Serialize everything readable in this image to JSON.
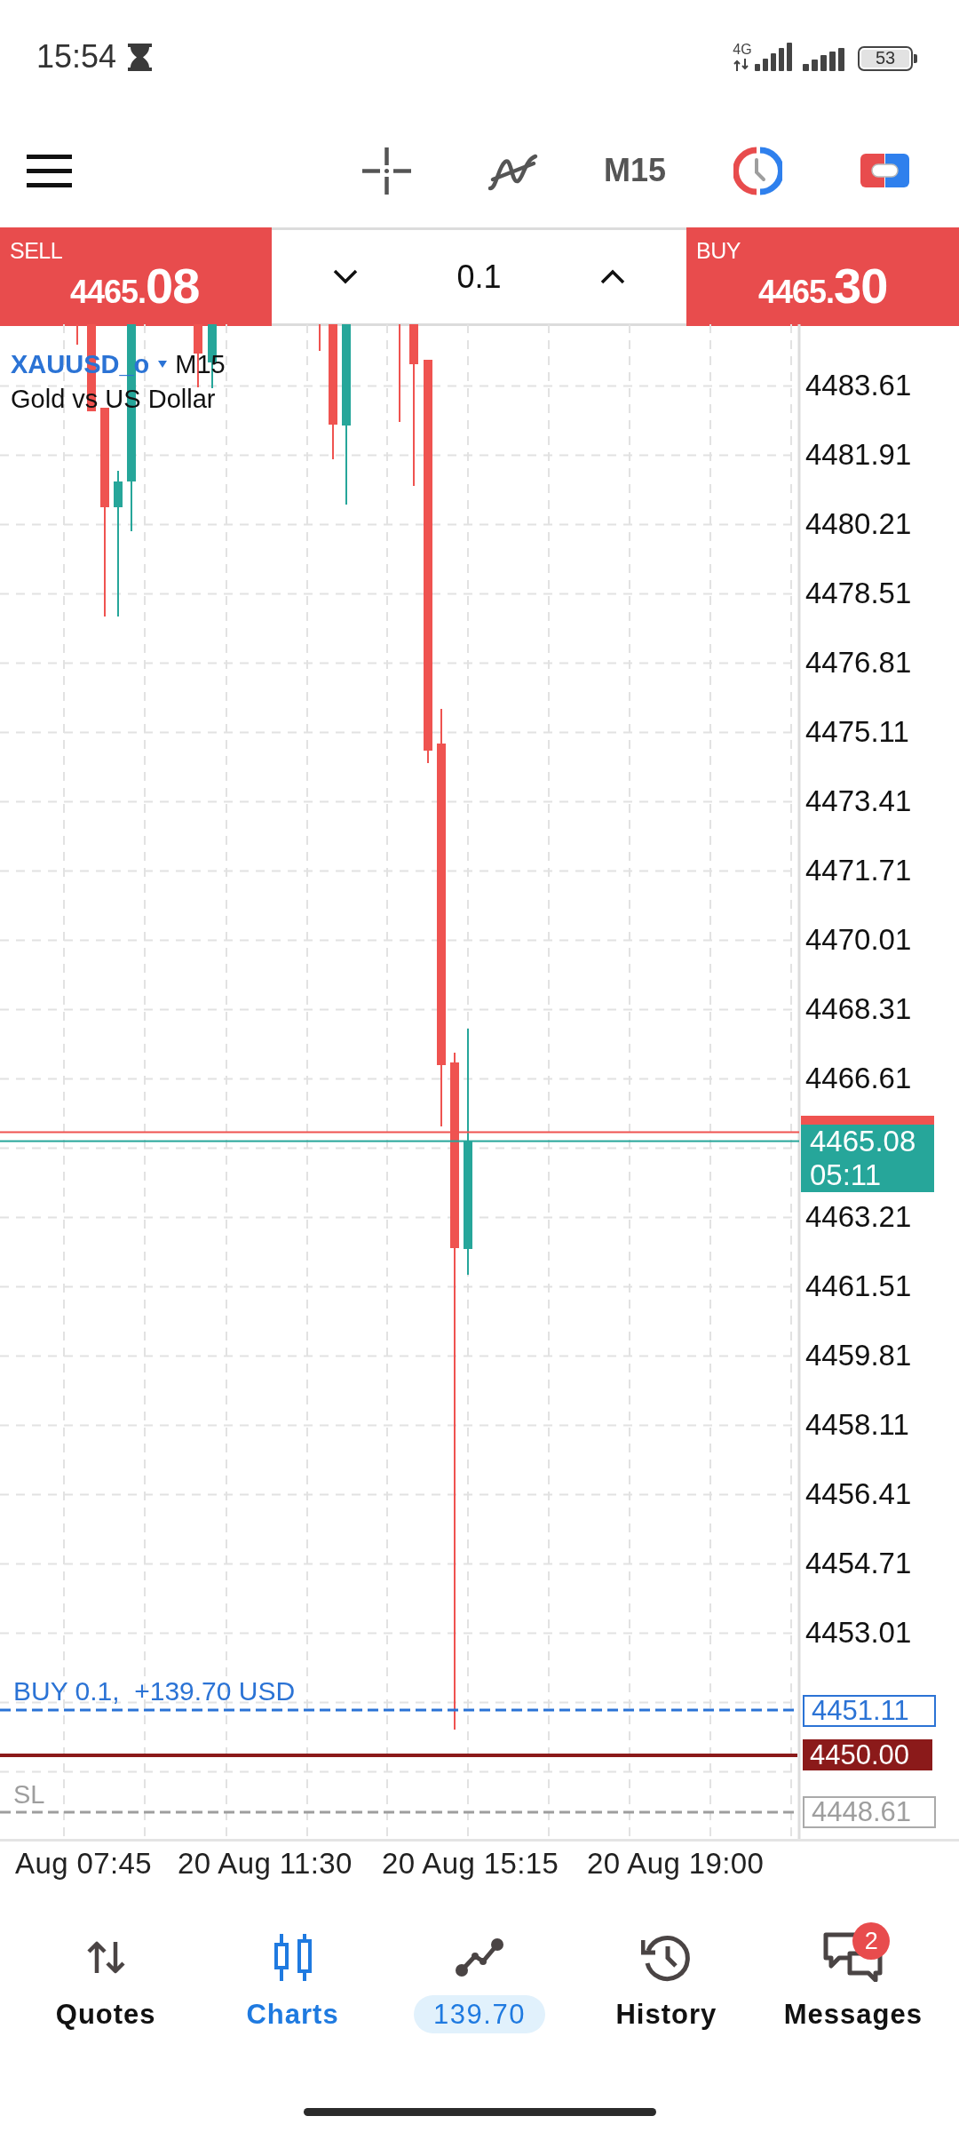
{
  "status_bar": {
    "time": "15:54",
    "network": "4G",
    "battery": "53"
  },
  "toolbar": {
    "timeframe": "M15"
  },
  "trade_panel": {
    "sell": {
      "label": "SELL",
      "price_main": "4465.",
      "price_pips": "08"
    },
    "volume": "0.1",
    "buy": {
      "label": "BUY",
      "price_main": "4465.",
      "price_pips": "30"
    }
  },
  "chart": {
    "symbol": "XAUUSD_o",
    "timeframe": "M15",
    "description": "Gold vs US Dollar",
    "price_axis": [
      "4483.61",
      "4481.91",
      "4480.21",
      "4478.51",
      "4476.81",
      "4475.11",
      "4473.41",
      "4471.71",
      "4470.01",
      "4468.31",
      "4466.61",
      "4463.21",
      "4461.51",
      "4459.81",
      "4458.11",
      "4456.41",
      "4454.71",
      "4453.01"
    ],
    "current_price": {
      "bid": "4465.08",
      "countdown": "05:11"
    },
    "position": {
      "label": "BUY 0.1,  +139.70 USD",
      "price": "4451.11"
    },
    "level_line": {
      "price": "4450.00"
    },
    "stop_loss": {
      "label": "SL",
      "price": "4448.61"
    },
    "time_axis": [
      "Aug 07:45",
      "20 Aug 11:30",
      "20 Aug 15:15",
      "20 Aug 19:00"
    ]
  },
  "bottom_nav": [
    {
      "kind": "tab",
      "label": "Quotes",
      "selected": false
    },
    {
      "kind": "tab",
      "label": "Charts",
      "selected": true
    },
    {
      "kind": "profit",
      "label": "139.70",
      "selected": false
    },
    {
      "kind": "tab",
      "label": "History",
      "selected": false
    },
    {
      "kind": "tab",
      "label": "Messages",
      "selected": false,
      "badge": "2"
    }
  ]
}
